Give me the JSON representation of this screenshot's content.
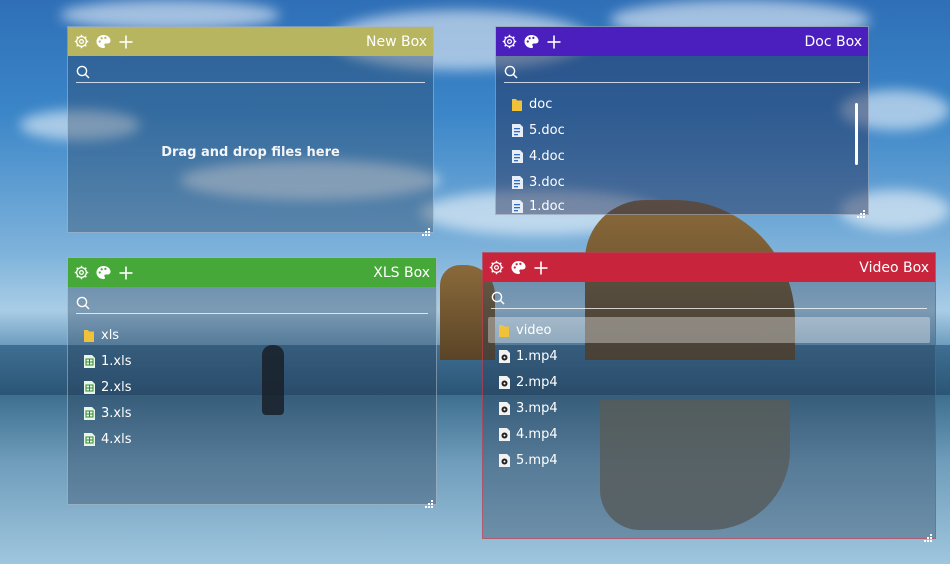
{
  "colors": {
    "new_box": "#b7b560",
    "doc_box": "#4b1fbe",
    "xls_box": "#47a83a",
    "video_box": "#c8243c"
  },
  "icons": {
    "settings": "gear-icon",
    "palette": "palette-icon",
    "add": "plus-icon",
    "search": "search-icon",
    "folder": "folder-icon",
    "doc_file": "doc-file-icon",
    "xls_file": "xls-file-icon",
    "video_file": "video-file-icon",
    "resize": "resize-grip-icon"
  },
  "new_box": {
    "title": "New Box",
    "empty_text": "Drag and drop files here"
  },
  "doc_box": {
    "title": "Doc Box",
    "items": [
      "doc",
      "5.doc",
      "4.doc",
      "3.doc",
      "1.doc"
    ]
  },
  "xls_box": {
    "title": "XLS Box",
    "items": [
      "xls",
      "1.xls",
      "2.xls",
      "3.xls",
      "4.xls"
    ]
  },
  "video_box": {
    "title": "Video Box",
    "items": [
      "video",
      "1.mp4",
      "2.mp4",
      "3.mp4",
      "4.mp4",
      "5.mp4"
    ]
  }
}
